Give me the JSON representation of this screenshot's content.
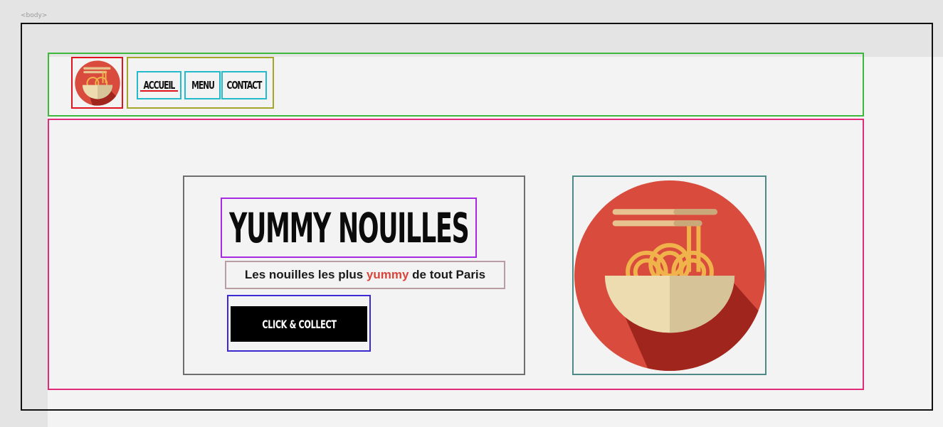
{
  "devtools": {
    "body_tag": "<body>"
  },
  "nav": {
    "items": [
      {
        "label": "ACCUEIL",
        "active": true
      },
      {
        "label": "MENU",
        "active": false
      },
      {
        "label": "CONTACT",
        "active": false
      }
    ]
  },
  "hero": {
    "title": "YUMMY NOUILLES",
    "subtitle_before": "Les nouilles les plus ",
    "subtitle_accent": "yummy",
    "subtitle_after": " de tout Paris",
    "cta_label": "CLICK & COLLECT"
  },
  "icons": {
    "logo": "noodle-bowl-icon",
    "hero_image": "noodle-bowl-icon"
  },
  "colors": {
    "accent": "#d9453b",
    "button_bg": "#000000",
    "bowl_red": "#d94c3d",
    "bowl_cream": "#ecdcaf",
    "noodle": "#f0b24a"
  }
}
